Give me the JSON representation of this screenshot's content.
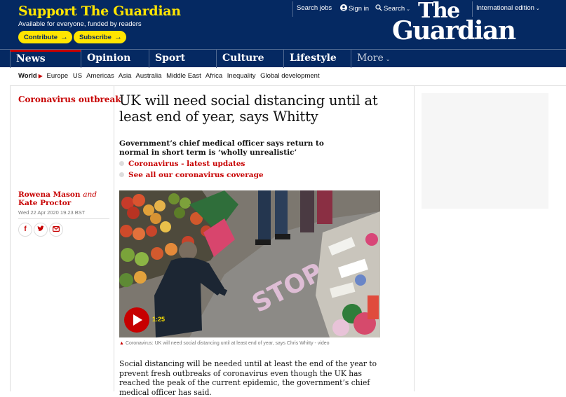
{
  "banner": {
    "support_title": "Support The Guardian",
    "support_sub": "Available for everyone, funded by readers",
    "contribute_label": "Contribute",
    "subscribe_label": "Subscribe",
    "search_jobs": "Search jobs",
    "sign_in": "Sign in",
    "search": "Search",
    "edition": "International edition",
    "logo_the": "The",
    "logo_guardian": "Guardian"
  },
  "nav": {
    "items": [
      "News",
      "Opinion",
      "Sport",
      "Culture",
      "Lifestyle"
    ],
    "more": "More"
  },
  "subnav": {
    "current": "World",
    "items": [
      "Europe",
      "US",
      "Americas",
      "Asia",
      "Australia",
      "Middle East",
      "Africa",
      "Inequality",
      "Global development"
    ]
  },
  "article": {
    "kicker": "Coronavirus outbreak",
    "headline": "UK will need social distancing until at least end of year, says Whitty",
    "standfirst": "Government’s chief medical officer says return to normal in short term is ‘wholly unrealistic’",
    "related": [
      "Coronavirus - latest updates",
      "See all our coronavirus coverage"
    ],
    "byline_author1": "Rowena Mason",
    "byline_and": "and",
    "byline_author2": "Kate Proctor",
    "dateline": "Wed 22 Apr 2020 19.23 BST",
    "share_icons": [
      "facebook-icon",
      "twitter-icon",
      "email-icon"
    ],
    "video_duration": "1:25",
    "caption": "Coronavirus: UK will need social distancing until at least end of year, says Chris Whitty - video",
    "body": "Social distancing will be needed until at least the end of the year to prevent fresh outbreaks of coronavirus even though the UK has reached the peak of the current epidemic, the government’s chief medical officer has said."
  },
  "colors": {
    "brand_blue": "#052962",
    "accent_yellow": "#ffe500",
    "news_red": "#c70000"
  }
}
